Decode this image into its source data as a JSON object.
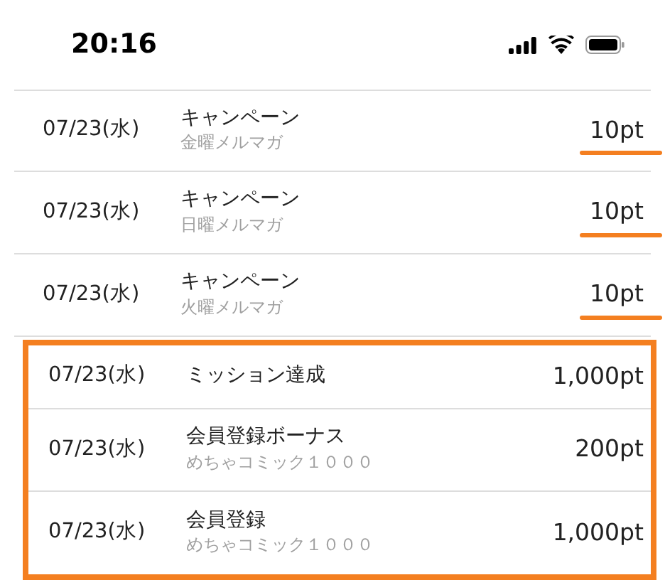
{
  "status_bar": {
    "time": "20:16"
  },
  "rows": [
    {
      "date": "07/23(水)",
      "title": "キャンペーン",
      "subtitle": "金曜メルマガ",
      "amount": "10pt",
      "underlined": true,
      "boxed": false
    },
    {
      "date": "07/23(水)",
      "title": "キャンペーン",
      "subtitle": "日曜メルマガ",
      "amount": "10pt",
      "underlined": true,
      "boxed": false
    },
    {
      "date": "07/23(水)",
      "title": "キャンペーン",
      "subtitle": "火曜メルマガ",
      "amount": "10pt",
      "underlined": true,
      "boxed": false
    },
    {
      "date": "07/23(水)",
      "title": "ミッション達成",
      "amount": "1,000pt",
      "underlined": false,
      "boxed": true
    },
    {
      "date": "07/23(水)",
      "title": "会員登録ボーナス",
      "subtitle": "めちゃコミック１０００",
      "amount": "200pt",
      "underlined": false,
      "boxed": true
    },
    {
      "date": "07/23(水)",
      "title": "会員登録",
      "subtitle": "めちゃコミック１０００",
      "amount": "1,000pt",
      "underlined": false,
      "boxed": true
    }
  ]
}
